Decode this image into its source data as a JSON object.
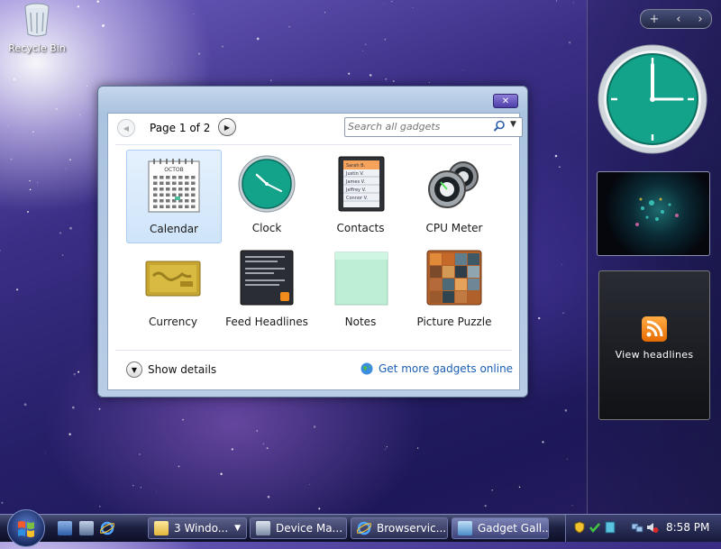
{
  "desktop": {
    "recycle_bin_label": "Recycle Bin"
  },
  "sidebar": {
    "controls": {
      "add": "+",
      "prev": "‹",
      "next": "›"
    },
    "feed_gadget_label": "View headlines"
  },
  "gallery": {
    "page_label": "Page 1 of 2",
    "search_placeholder": "Search all gadgets",
    "gadgets": [
      {
        "name": "Calendar",
        "icon": "calendar-icon",
        "selected": true
      },
      {
        "name": "Clock",
        "icon": "clock-icon",
        "selected": false
      },
      {
        "name": "Contacts",
        "icon": "contacts-icon",
        "selected": false
      },
      {
        "name": "CPU Meter",
        "icon": "cpu-meter-icon",
        "selected": false
      },
      {
        "name": "Currency",
        "icon": "currency-icon",
        "selected": false
      },
      {
        "name": "Feed Headlines",
        "icon": "feed-headlines-icon",
        "selected": false
      },
      {
        "name": "Notes",
        "icon": "notes-icon",
        "selected": false
      },
      {
        "name": "Picture Puzzle",
        "icon": "picture-puzzle-icon",
        "selected": false
      }
    ],
    "calendar_month": "OCTOB",
    "contacts_names": [
      "Sarah B.",
      "Justin V.",
      "James V.",
      "Jeffrey V.",
      "Connor V."
    ],
    "show_details_label": "Show details",
    "get_more_label": "Get more gadgets online"
  },
  "taskbar": {
    "tasks": [
      {
        "label": "3 Windo...",
        "icon": "folder-icon",
        "has_menu": true
      },
      {
        "label": "Device Ma...",
        "icon": "device-manager-icon"
      },
      {
        "label": "Browservic...",
        "icon": "internet-explorer-icon"
      },
      {
        "label": "Gadget Gall...",
        "icon": "gadget-gallery-icon",
        "active": true
      }
    ],
    "time": "8:58 PM"
  },
  "colors": {
    "accent": "#1a5fb4",
    "clock_face": "#12a38a",
    "selection": "#cfe4fa"
  }
}
